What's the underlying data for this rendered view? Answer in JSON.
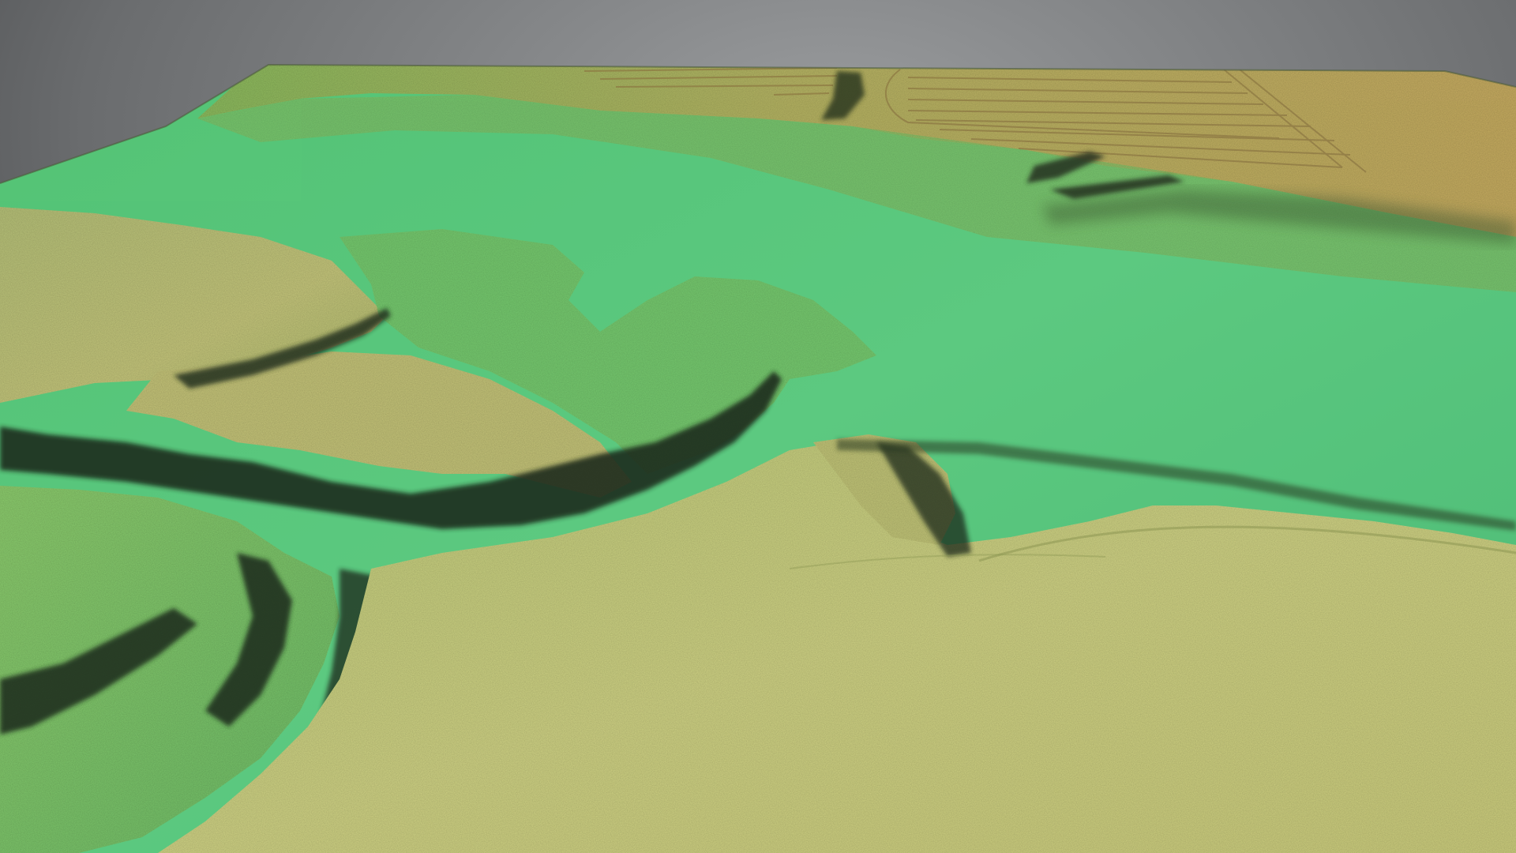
{
  "scene": {
    "subject": "terrain-elevation-render",
    "colors": {
      "background_top": "#3a3b3d",
      "background_bottom": "#8e9092",
      "lowland_green": "#57c97a",
      "midland_green": "#6fc96a",
      "upland_yellow": "#c9cf7f",
      "highland_tan": "#c8b86c",
      "shadow": "#1f2a1a"
    },
    "features": {
      "valley_floor": "green-lowland",
      "plateaus": [
        "left-ridge",
        "right-field",
        "lower-foreground"
      ],
      "field_lines": "plowed-field-furrows",
      "escarpments": "dark-cliff-edges"
    }
  }
}
